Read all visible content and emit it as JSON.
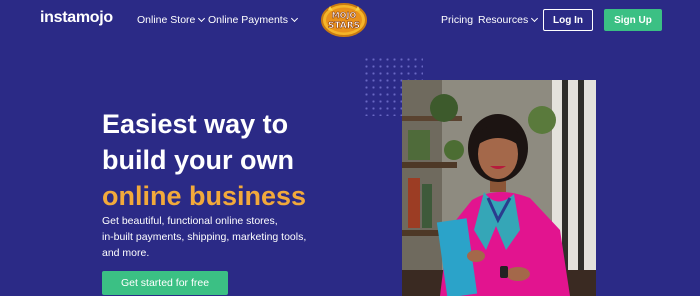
{
  "nav": {
    "logo": "instamojo",
    "items": [
      {
        "label": "Online Store"
      },
      {
        "label": "Online Payments"
      }
    ],
    "badge_line1": "MOJO",
    "badge_line2": "STARS",
    "right_items": [
      {
        "label": "Pricing"
      },
      {
        "label": "Resources"
      }
    ],
    "login_label": "Log In",
    "signup_label": "Sign Up"
  },
  "hero": {
    "headline_line1": "Easiest way to",
    "headline_line2": "build your own",
    "headline_accent": "online business",
    "subtext_line1": "Get beautiful, functional online stores,",
    "subtext_line2": "in-built payments, shipping, marketing tools,",
    "subtext_line3": "and more.",
    "cta_label": "Get started for free"
  },
  "colors": {
    "background": "#2b2a86",
    "accent": "#f2a93b",
    "cta_green": "#3bc084"
  },
  "icons": {
    "dropdown": "chevron-down-icon",
    "badge": "mojo-stars-badge"
  }
}
